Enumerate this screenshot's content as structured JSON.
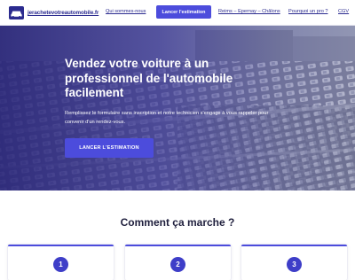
{
  "header": {
    "logo_text": "jerachetevotreautomobile.fr",
    "logo_icon": "car-icon",
    "nav": {
      "qui": "Qui sommes-nous",
      "cta": "Lancer l'estimation",
      "cities": "Reims – Epernay – Châlons",
      "pourquoi": "Pourquoi un pro ?",
      "cgv": "CGV"
    }
  },
  "hero": {
    "title": "Vendez votre voiture à un professionnel de l'automobile facilement",
    "subtitle": "Remplissez le formulaire sans inscription et notre technicien s'engage à vous rappeler pour convenir d'un rendez-vous.",
    "button": "LANCER L'ESTIMATION"
  },
  "how": {
    "title": "Comment ça marche ?",
    "steps": [
      "1",
      "2",
      "3"
    ]
  },
  "colors": {
    "accent": "#4c4cdc",
    "brand_text": "#2b2b8f"
  }
}
